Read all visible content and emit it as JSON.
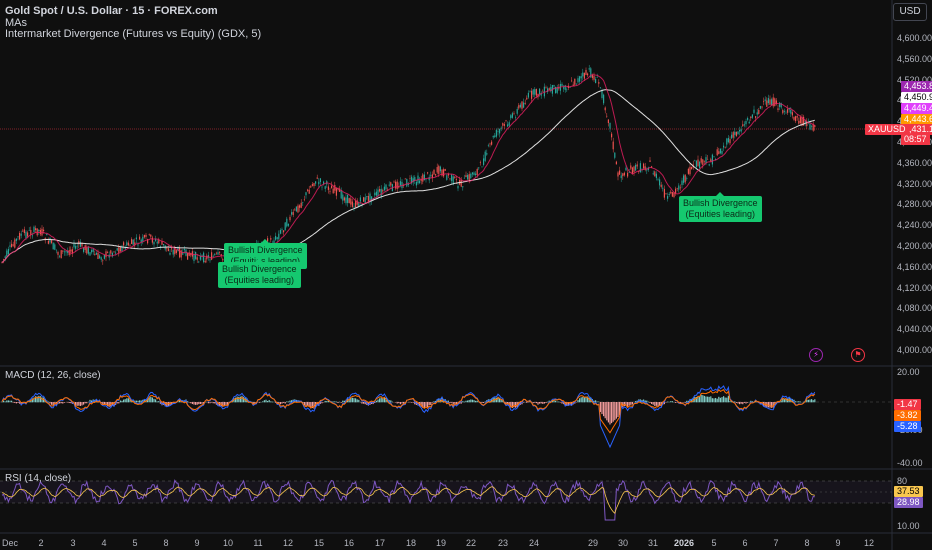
{
  "header": {
    "symbol_line": "Gold Spot / U.S. Dollar · 15 · FOREX.com",
    "indicator_1": "MAs",
    "indicator_2": "Intermarket Divergence (Futures vs Equity) (GDX, 5)"
  },
  "currency_button": "USD",
  "price_axis": {
    "ticks": [
      "4,600.00",
      "4,560.00",
      "4,520.00",
      "4,480.00",
      "4,440.00",
      "4,400.00",
      "4,360.00",
      "4,320.00",
      "4,280.00",
      "4,240.00",
      "4,200.00",
      "4,160.00",
      "4,120.00",
      "4,080.00",
      "4,040.00",
      "4,000.00"
    ],
    "tags": [
      {
        "text": "4,453.80",
        "color": "#9c27b0"
      },
      {
        "text": "4,450.91",
        "color": "#ffffff",
        "fg": "#000000"
      },
      {
        "text": "4,449.42",
        "color": "#e040fb"
      },
      {
        "text": "4,443.60",
        "color": "#ff9800"
      },
      {
        "text": "4,431.12",
        "color": "#f23645"
      },
      {
        "text": "08:57",
        "color": "#f23645"
      }
    ],
    "symbol_tag": "XAUUSD"
  },
  "annotations": [
    {
      "line1": "Bullish Divergence",
      "line2": "(Equities leading)"
    },
    {
      "line1": "Bullish Divergence",
      "line2": "(Equities leading)"
    },
    {
      "line1": "Bullish Divergence",
      "line2": "(Equities leading)"
    }
  ],
  "macd": {
    "title": "MACD (12, 26, close)",
    "ticks": [
      "20.00",
      "-20.00",
      "-40.00"
    ],
    "tags": [
      {
        "text": "-1.47",
        "color": "#f23645"
      },
      {
        "text": "-3.82",
        "color": "#ff6d00"
      },
      {
        "text": "-5.28",
        "color": "#2962ff"
      }
    ]
  },
  "rsi": {
    "title": "RSI (14, close)",
    "ticks": [
      "80",
      "10.00"
    ],
    "tags": [
      {
        "text": "37.53",
        "color": "#f9c74f",
        "fg": "#000000"
      },
      {
        "text": "28.98",
        "color": "#7e57c2"
      }
    ]
  },
  "time_axis": [
    "Dec",
    "2",
    "3",
    "4",
    "5",
    "8",
    "9",
    "10",
    "11",
    "12",
    "15",
    "16",
    "17",
    "18",
    "19",
    "22",
    "23",
    "24",
    "29",
    "30",
    "31",
    "2026",
    "5",
    "6",
    "7",
    "8",
    "9",
    "12"
  ],
  "colors": {
    "background": "#0f0f0f",
    "candle_up": "#26a69a",
    "candle_down": "#ef5350",
    "ma_fast": "#e91e63",
    "ma_slow": "#e0e0e0",
    "label_green": "#15c86f"
  },
  "icons": [
    "lightning-icon",
    "flag-icon"
  ]
}
